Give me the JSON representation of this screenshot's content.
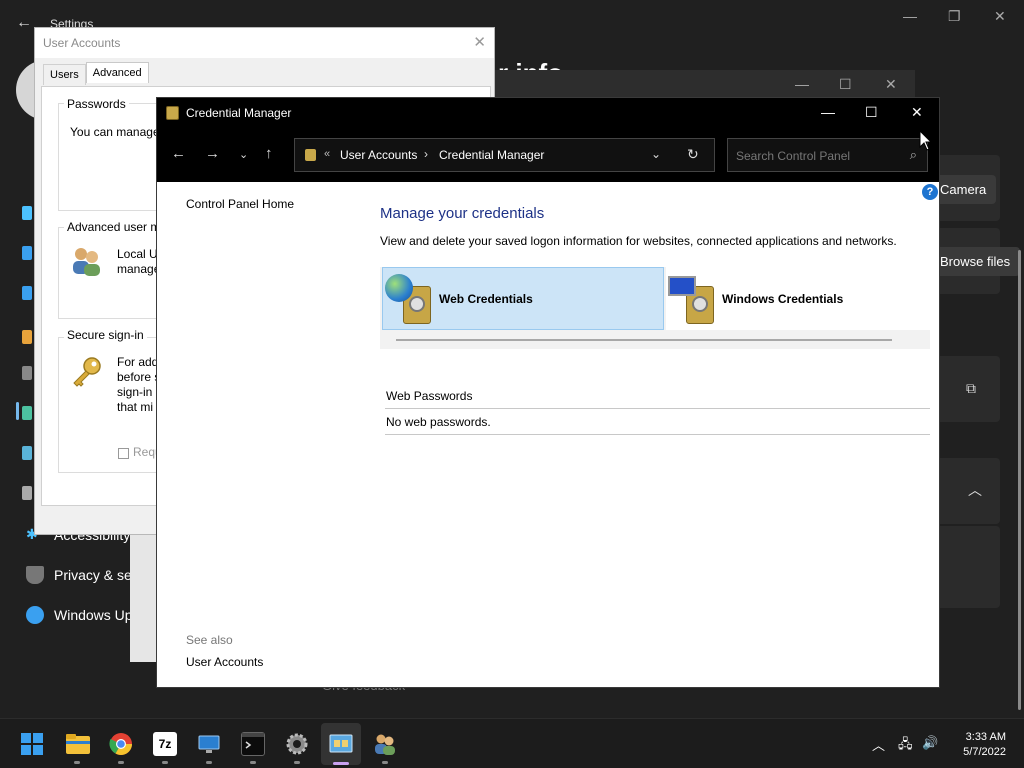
{
  "settings_bg": {
    "title": "Settings",
    "heading_partial": "r info",
    "nav_items": [
      {
        "label": "Accessibility",
        "icon": "accessibility-icon"
      },
      {
        "label": "Privacy & security",
        "icon": "shield-icon"
      },
      {
        "label": "Windows Update",
        "icon": "windows-update-icon"
      }
    ],
    "pill_1": "Camera",
    "pill_2": "Browse files",
    "feedback": "Give feedback"
  },
  "user_accounts": {
    "title": "User Accounts",
    "tabs": [
      "Users",
      "Advanced"
    ],
    "active_tab": "Advanced",
    "passwords_label": "Passwords",
    "passwords_text": "You can manage",
    "advanced_label": "Advanced user m",
    "advanced_text_1": "Local U",
    "advanced_text_2": "manage",
    "secure_label": "Secure sign-in",
    "secure_text_1": "For add",
    "secure_text_2": "before s",
    "secure_text_3": "sign-in",
    "secure_text_4": "that mi",
    "checkbox_label": "Requ"
  },
  "credential_manager": {
    "title": "Credential Manager",
    "breadcrumb": [
      "User Accounts",
      "Credential Manager"
    ],
    "breadcrumb_prefix": "«",
    "search_placeholder": "Search Control Panel",
    "side_home": "Control Panel Home",
    "see_also": "See also",
    "see_also_link": "User Accounts",
    "heading": "Manage your credentials",
    "description": "View and delete your saved logon information for websites, connected applications and networks.",
    "tiles": [
      {
        "label": "Web Credentials",
        "selected": true,
        "icon": "web-credentials-vault-icon"
      },
      {
        "label": "Windows Credentials",
        "selected": false,
        "icon": "windows-credentials-vault-icon"
      }
    ],
    "section_heading": "Web Passwords",
    "empty_text": "No web passwords.",
    "help_glyph": "?"
  },
  "taskbar": {
    "apps": [
      {
        "name": "start-button",
        "color": "#3aa0f0"
      },
      {
        "name": "file-explorer-icon",
        "color": "#f3c13a"
      },
      {
        "name": "chrome-icon",
        "color": "#e34133"
      },
      {
        "name": "7zip-icon",
        "color": "#ffffff"
      },
      {
        "name": "remote-desktop-icon",
        "color": "#2a7fd0"
      },
      {
        "name": "terminal-icon",
        "color": "#0c0c0c"
      },
      {
        "name": "settings-icon",
        "color": "#8a8a8a"
      },
      {
        "name": "control-panel-icon",
        "color": "#5aa8e0"
      },
      {
        "name": "user-accounts-icon",
        "color": "#d9a86a"
      }
    ],
    "time": "3:33 AM",
    "date": "5/7/2022"
  }
}
